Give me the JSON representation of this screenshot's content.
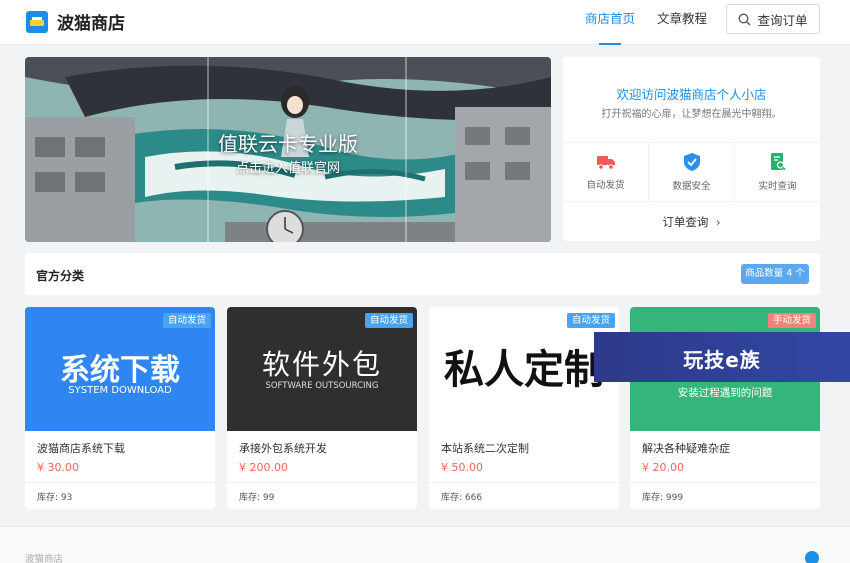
{
  "header": {
    "brand": "波猫商店",
    "nav": [
      {
        "label": "商店首页",
        "active": true
      },
      {
        "label": "文章教程",
        "active": false
      }
    ],
    "search_button": "查询订单"
  },
  "banner": {
    "title": "值联云卡专业版",
    "subtitle": "点击进入值联官网"
  },
  "info": {
    "title": "欢迎访问波猫商店个人小店",
    "subtitle": "打开祝福的心扉，让梦想在晨光中翱翔。",
    "features": [
      {
        "label": "自动发货",
        "icon": "delivery-truck-icon",
        "color": "#f25a5a"
      },
      {
        "label": "数据安全",
        "icon": "shield-check-icon",
        "color": "#2e8fe6"
      },
      {
        "label": "实时查询",
        "icon": "document-search-icon",
        "color": "#27b26b"
      }
    ],
    "link": "订单查询"
  },
  "category": {
    "title": "官方分类",
    "count_label": "商品数量 4 个"
  },
  "products": [
    {
      "name": "波猫商店系统下载",
      "price": "¥ 30.00",
      "stock": "库存: 93",
      "badge": "自动发货",
      "thumb_title": "系统下载",
      "thumb_sub": "SYSTEM DOWNLOAD"
    },
    {
      "name": "承接外包系统开发",
      "price": "¥ 200.00",
      "stock": "库存: 99",
      "badge": "自动发货",
      "thumb_title": "软件外包",
      "thumb_sub": "SOFTWARE OUTSOURCING"
    },
    {
      "name": "本站系统二次定制",
      "price": "¥ 50.00",
      "stock": "库存: 666",
      "badge": "自动发货",
      "thumb_title": "私人定制"
    },
    {
      "name": "解决各种疑难杂症",
      "price": "¥ 20.00",
      "stock": "库存: 999",
      "badge": "手动发货",
      "thumb_sub": "安装过程遇到的问题"
    }
  ],
  "watermark": "玩技e族",
  "footer": {
    "text": "波猫商店"
  }
}
